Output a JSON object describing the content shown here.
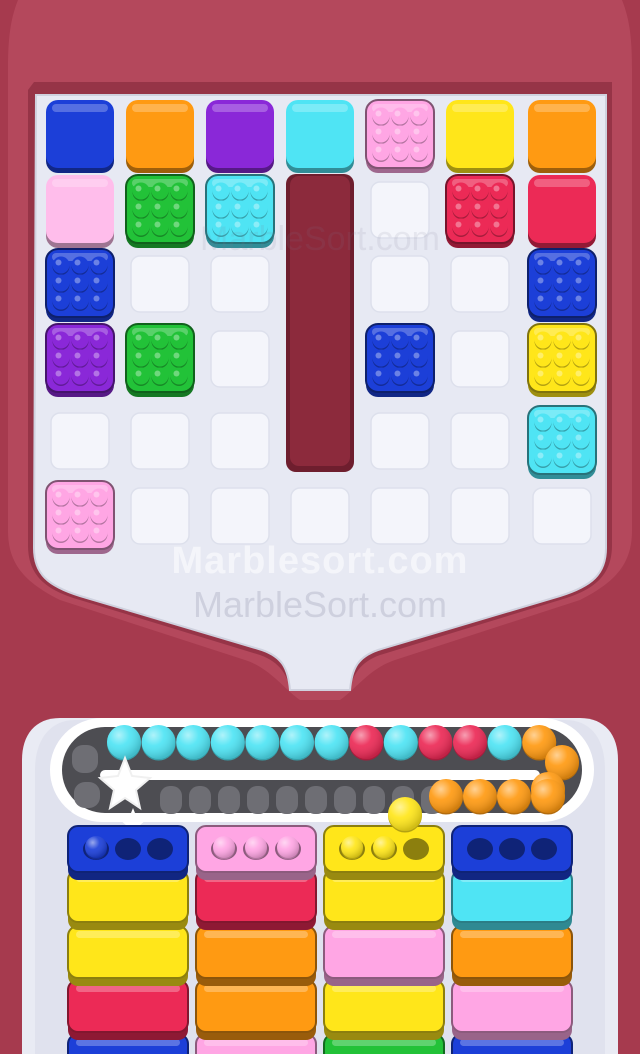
{
  "colors": {
    "frame": "#a63a4e",
    "frame_dark": "#7e2436",
    "board_bg": "#e7e9f3",
    "empty_cell": "#f4f5fb",
    "tray": "#ffffff",
    "track": "#5a5a5a",
    "divider": "#8c2a3c"
  },
  "palette": {
    "blue": "#1c3fd8",
    "orange": "#ff9a12",
    "purple": "#8a28d8",
    "cyan": "#4fe4f4",
    "pink": "#ffa6e4",
    "yellow": "#ffe61a",
    "red": "#ec2a56",
    "green": "#22c238",
    "lightpink": "#ffbdeb"
  },
  "board": {
    "rows": [
      [
        {
          "color": "blue",
          "type": "plain"
        },
        {
          "color": "orange",
          "type": "plain"
        },
        {
          "color": "purple",
          "type": "plain"
        },
        {
          "color": "cyan",
          "type": "plain"
        },
        {
          "color": "pink",
          "type": "bubble"
        },
        {
          "color": "yellow",
          "type": "plain"
        },
        {
          "color": "orange",
          "type": "plain"
        }
      ],
      [
        {
          "color": "lightpink",
          "type": "plain"
        },
        {
          "color": "green",
          "type": "bubble"
        },
        {
          "color": "cyan",
          "type": "bubble"
        },
        {
          "type": "wall"
        },
        {
          "type": "empty"
        },
        {
          "color": "red",
          "type": "bubble"
        },
        {
          "color": "red",
          "type": "plain"
        }
      ],
      [
        {
          "color": "blue",
          "type": "bubble"
        },
        {
          "type": "empty"
        },
        {
          "type": "empty"
        },
        {
          "type": "wall"
        },
        {
          "type": "empty"
        },
        {
          "type": "empty"
        },
        {
          "color": "blue",
          "type": "bubble"
        }
      ],
      [
        {
          "color": "purple",
          "type": "bubble"
        },
        {
          "color": "green",
          "type": "bubble"
        },
        {
          "type": "empty"
        },
        {
          "type": "wall"
        },
        {
          "color": "blue",
          "type": "bubble"
        },
        {
          "type": "empty"
        },
        {
          "color": "yellow",
          "type": "bubble"
        }
      ],
      [
        {
          "type": "empty"
        },
        {
          "type": "empty"
        },
        {
          "type": "empty"
        },
        {
          "type": "wall"
        },
        {
          "type": "empty"
        },
        {
          "type": "empty"
        },
        {
          "color": "cyan",
          "type": "bubble"
        }
      ],
      [
        {
          "color": "pink",
          "type": "bubble"
        },
        {
          "type": "empty"
        },
        {
          "type": "empty"
        },
        {
          "type": "empty"
        },
        {
          "type": "empty"
        },
        {
          "type": "empty"
        },
        {
          "type": "empty"
        }
      ]
    ]
  },
  "conveyor": {
    "top_row": [
      "cyan",
      "cyan",
      "cyan",
      "cyan",
      "cyan",
      "cyan",
      "cyan",
      "red",
      "cyan",
      "red",
      "red",
      "cyan",
      "orange"
    ],
    "right_turn": [
      "orange",
      "orange"
    ],
    "bottom_row": [
      "orange",
      "orange",
      "orange",
      "orange"
    ],
    "falling_marble": "yellow",
    "empty_slots": 10
  },
  "columns": [
    {
      "cap": {
        "color": "blue",
        "filled": 1,
        "holes": 3
      },
      "stack": [
        "yellow",
        "yellow",
        "red",
        "blue"
      ]
    },
    {
      "cap": {
        "color": "pink",
        "filled": 3,
        "holes": 3
      },
      "stack": [
        "red",
        "orange",
        "orange",
        "pink"
      ]
    },
    {
      "cap": {
        "color": "yellow",
        "filled": 2,
        "holes": 3
      },
      "stack": [
        "yellow",
        "pink",
        "yellow",
        "green"
      ]
    },
    {
      "cap": {
        "color": "blue",
        "filled": 0,
        "holes": 3
      },
      "stack": [
        "cyan",
        "orange",
        "pink",
        "blue"
      ]
    }
  ],
  "watermarks": [
    "Marblesort.com",
    "MarbleSort.com",
    "MarbleSort.com"
  ]
}
